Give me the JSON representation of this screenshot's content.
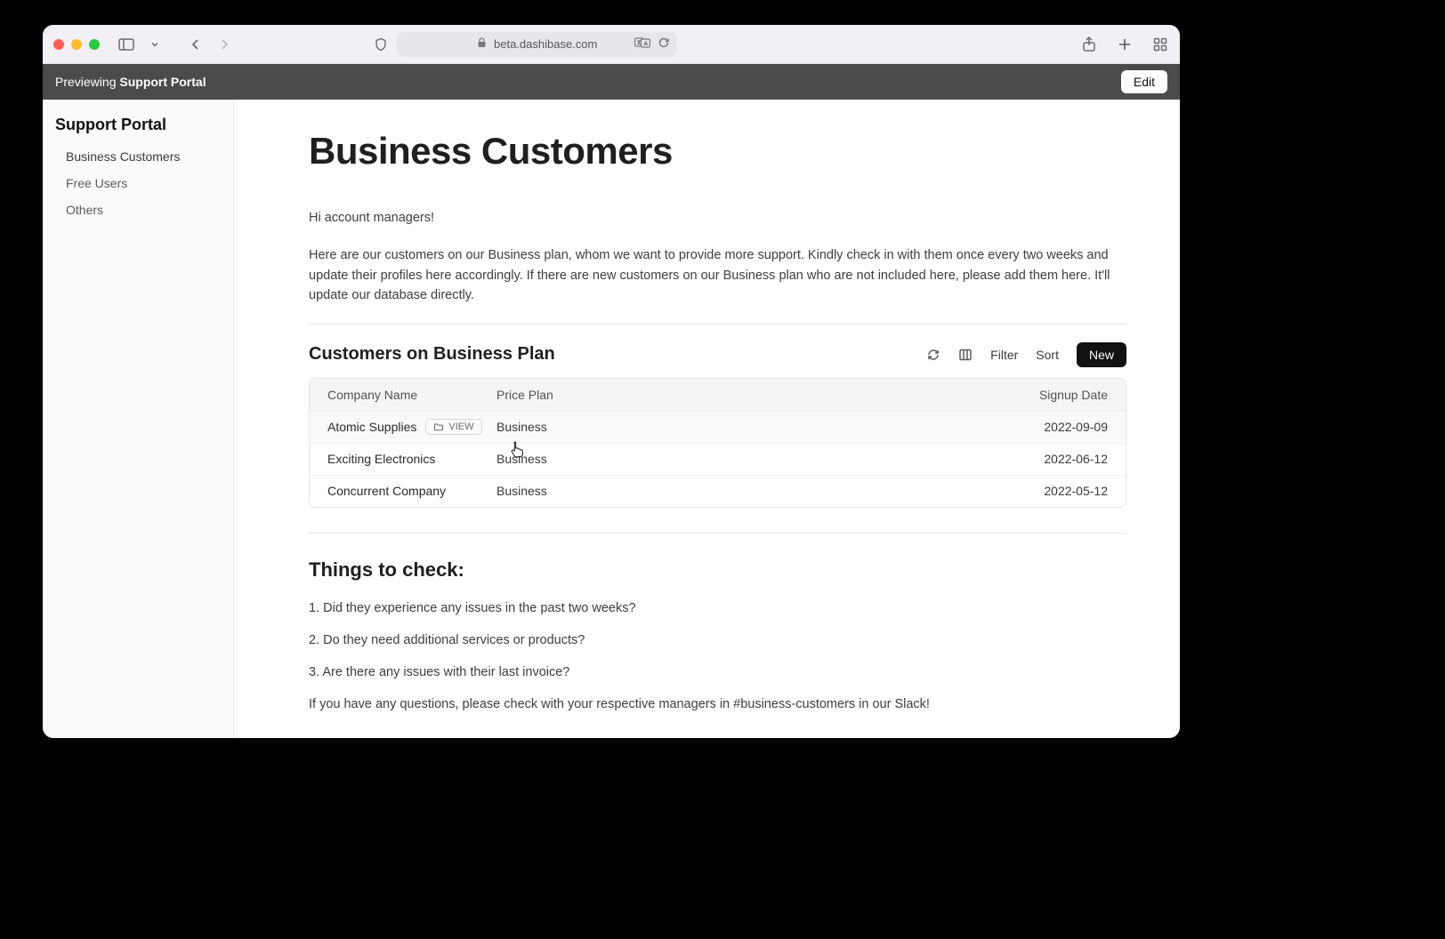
{
  "browser": {
    "url": "beta.dashibase.com"
  },
  "banner": {
    "prefix": "Previewing ",
    "name": "Support Portal",
    "edit_label": "Edit"
  },
  "sidebar": {
    "title": "Support Portal",
    "items": [
      {
        "label": "Business Customers"
      },
      {
        "label": "Free Users"
      },
      {
        "label": "Others"
      }
    ]
  },
  "page": {
    "title": "Business Customers",
    "intro1": "Hi account managers!",
    "intro2": "Here are our customers on our Business plan, whom we want to provide more support. Kindly check in with them once every two weeks and update their profiles here accordingly. If there are new customers on our Business plan who are not included here, please add them here. It'll update our database directly."
  },
  "table": {
    "title": "Customers on Business Plan",
    "filter_label": "Filter",
    "sort_label": "Sort",
    "new_label": "New",
    "view_label": "VIEW",
    "columns": {
      "c0": "Company Name",
      "c1": "Price Plan",
      "c2": "Signup Date"
    },
    "rows": [
      {
        "name": "Atomic Supplies",
        "plan": "Business",
        "date": "2022-09-09"
      },
      {
        "name": "Exciting Electronics",
        "plan": "Business",
        "date": "2022-06-12"
      },
      {
        "name": "Concurrent Company",
        "plan": "Business",
        "date": "2022-05-12"
      }
    ]
  },
  "checks": {
    "heading": "Things to check:",
    "q1": "1. Did they experience any issues in the past two weeks?",
    "q2": "2. Do they need additional services or products?",
    "q3": "3. Are there any issues with their last invoice?",
    "footer": "If you have any questions, please check with your respective managers in #business-customers in our Slack!"
  }
}
